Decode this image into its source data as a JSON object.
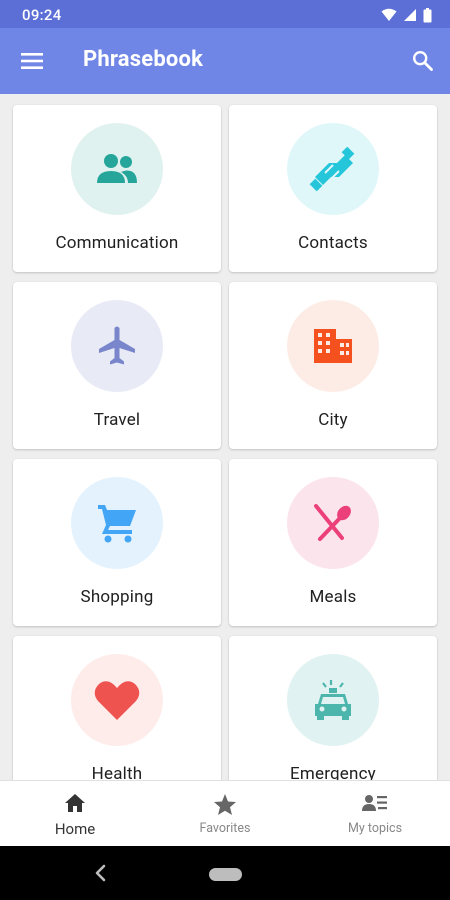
{
  "status_bar": {
    "time": "09:24"
  },
  "app_bar": {
    "title": "Phrasebook",
    "menu_icon": "menu-icon",
    "search_icon": "search-icon"
  },
  "categories": [
    {
      "label": "Communication",
      "icon": "people-icon",
      "circle_color": "#e0f2ef",
      "icon_color": "#26a69a"
    },
    {
      "label": "Contacts",
      "icon": "handshake-icon",
      "circle_color": "#e0f7fa",
      "icon_color": "#26c6da"
    },
    {
      "label": "Travel",
      "icon": "airplane-icon",
      "circle_color": "#e8eaf6",
      "icon_color": "#7986cb"
    },
    {
      "label": "City",
      "icon": "city-icon",
      "circle_color": "#fdece6",
      "icon_color": "#f4511e"
    },
    {
      "label": "Shopping",
      "icon": "shopping-cart-icon",
      "circle_color": "#e3f2fd",
      "icon_color": "#42a5f5"
    },
    {
      "label": "Meals",
      "icon": "utensils-icon",
      "circle_color": "#fce4ec",
      "icon_color": "#ec407a"
    },
    {
      "label": "Health",
      "icon": "heart-icon",
      "circle_color": "#fdecea",
      "icon_color": "#ef5350"
    },
    {
      "label": "Emergency",
      "icon": "ambulance-icon",
      "circle_color": "#e0f2f1",
      "icon_color": "#4db6ac"
    }
  ],
  "bottom_nav": {
    "items": [
      {
        "label": "Home",
        "icon": "home-icon",
        "active": true
      },
      {
        "label": "Favorites",
        "icon": "star-icon",
        "active": false
      },
      {
        "label": "My topics",
        "icon": "my-topics-icon",
        "active": false
      }
    ]
  },
  "system_nav": {
    "back_icon": "back-icon",
    "home_pill": "home-pill"
  }
}
